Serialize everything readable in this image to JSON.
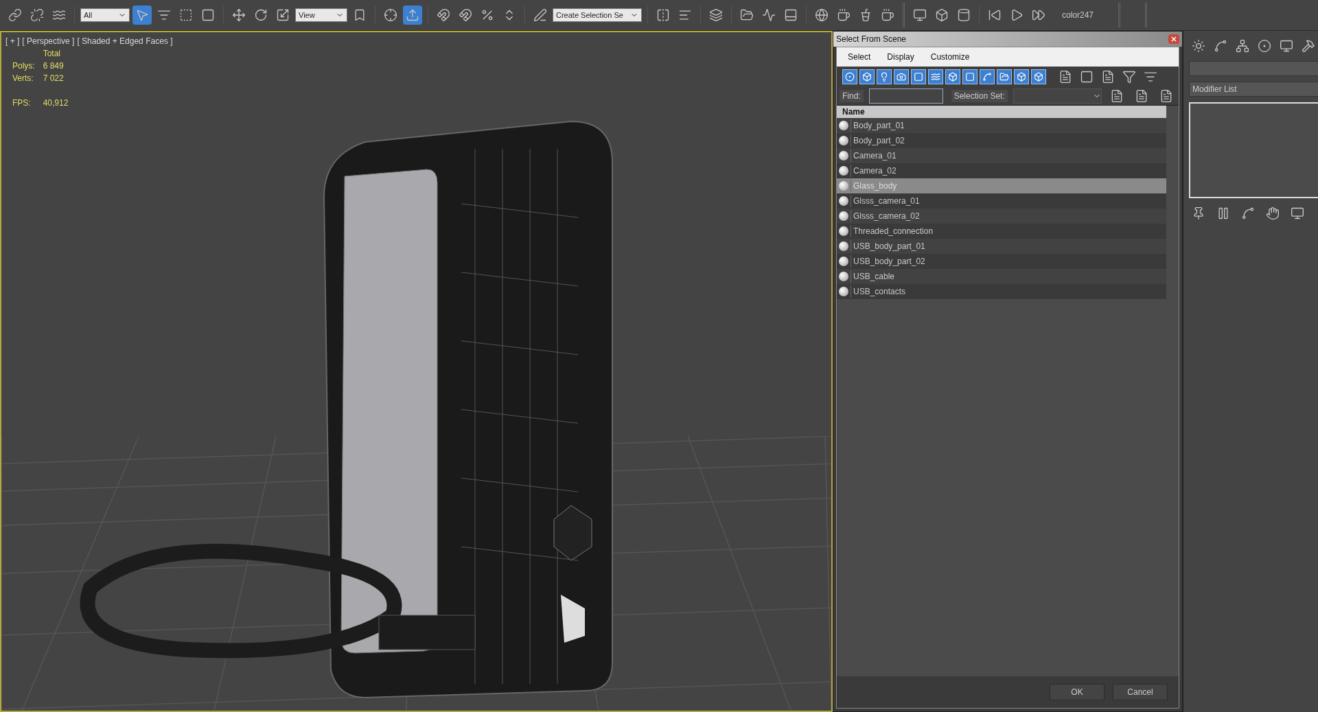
{
  "toolbar": {
    "filter_dropdown": "All",
    "reference_dropdown": "View",
    "selection_set_dropdown": "Create Selection Se",
    "label": "color247"
  },
  "viewport": {
    "labels": [
      "[ + ]",
      "[ Perspective ]",
      "[ Shaded + Edged Faces ]"
    ],
    "stats_header": "Total",
    "stats": [
      {
        "label": "Polys:",
        "value": "6 849"
      },
      {
        "label": "Verts:",
        "value": "7 022"
      },
      {
        "label": "FPS:",
        "value": "40,912"
      }
    ]
  },
  "dialog": {
    "title": "Select From Scene",
    "menu": [
      "Select",
      "Display",
      "Customize"
    ],
    "filter_toggles": [
      {
        "on": true
      },
      {
        "on": true
      },
      {
        "on": true
      },
      {
        "on": true
      },
      {
        "on": true
      },
      {
        "on": true
      },
      {
        "on": true
      },
      {
        "on": true
      },
      {
        "on": true
      },
      {
        "on": true
      },
      {
        "on": true
      },
      {
        "on": true
      }
    ],
    "find_label": "Find:",
    "selection_set_label": "Selection Set:",
    "column": "Name",
    "rows": [
      {
        "name": "Body_part_01",
        "selected": false
      },
      {
        "name": "Body_part_02",
        "selected": false
      },
      {
        "name": "Camera_01",
        "selected": false
      },
      {
        "name": "Camera_02",
        "selected": false
      },
      {
        "name": "Glass_body",
        "selected": true
      },
      {
        "name": "Glsss_camera_01",
        "selected": false
      },
      {
        "name": "Glsss_camera_02",
        "selected": false
      },
      {
        "name": "Threaded_connection",
        "selected": false
      },
      {
        "name": "USB_body_part_01",
        "selected": false
      },
      {
        "name": "USB_body_part_02",
        "selected": false
      },
      {
        "name": "USB_cable",
        "selected": false
      },
      {
        "name": "USB_contacts",
        "selected": false
      }
    ],
    "buttons": [
      "OK",
      "Cancel"
    ]
  },
  "command_panel": {
    "modifier_list": "Modifier List"
  }
}
